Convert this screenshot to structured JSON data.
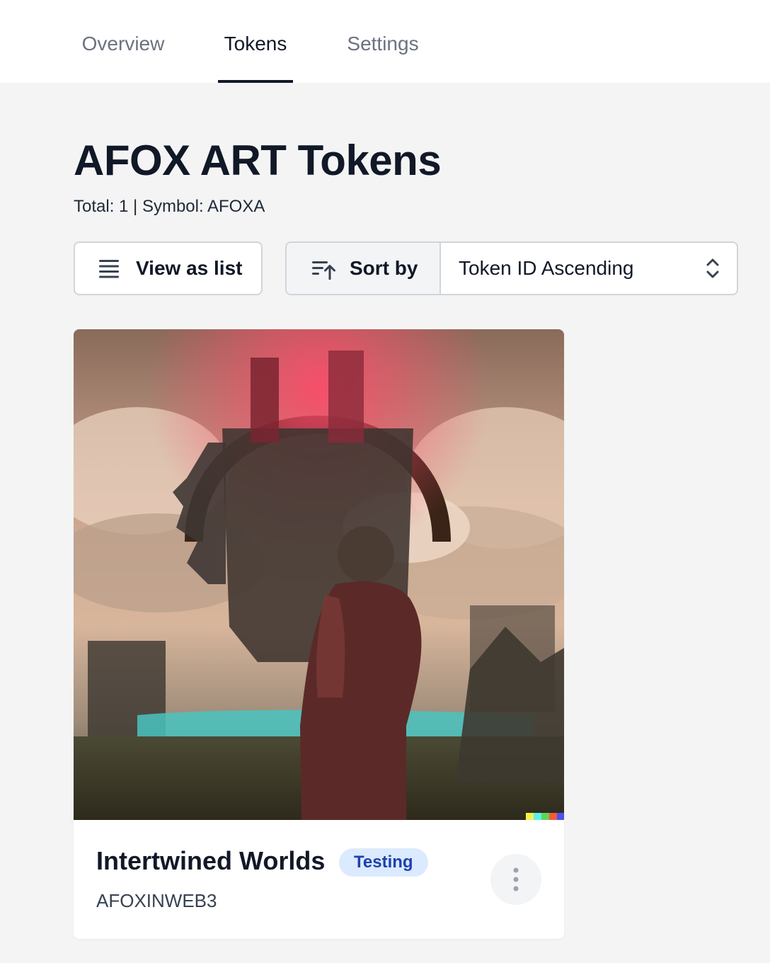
{
  "tabs": [
    {
      "label": "Overview",
      "active": false
    },
    {
      "label": "Tokens",
      "active": true
    },
    {
      "label": "Settings",
      "active": false
    }
  ],
  "page": {
    "title": "AFOX ART Tokens",
    "meta": "Total: 1 | Symbol: AFOXA"
  },
  "toolbar": {
    "view_list_label": "View as list",
    "view_list_icon": "list-icon",
    "sort_label": "Sort by",
    "sort_icon": "sort-ascending-icon",
    "sort_value": "Token ID Ascending",
    "sort_select_icon": "chevron-up-down-icon"
  },
  "tokens": [
    {
      "name": "Intertwined Worlds",
      "badge": "Testing",
      "collection": "AFOXINWEB3",
      "more_icon": "more-vertical-icon"
    }
  ],
  "colors": {
    "badge_bg": "#dbeafe",
    "badge_text": "#1e40af",
    "text_primary": "#111827",
    "background": "#f4f4f4"
  }
}
